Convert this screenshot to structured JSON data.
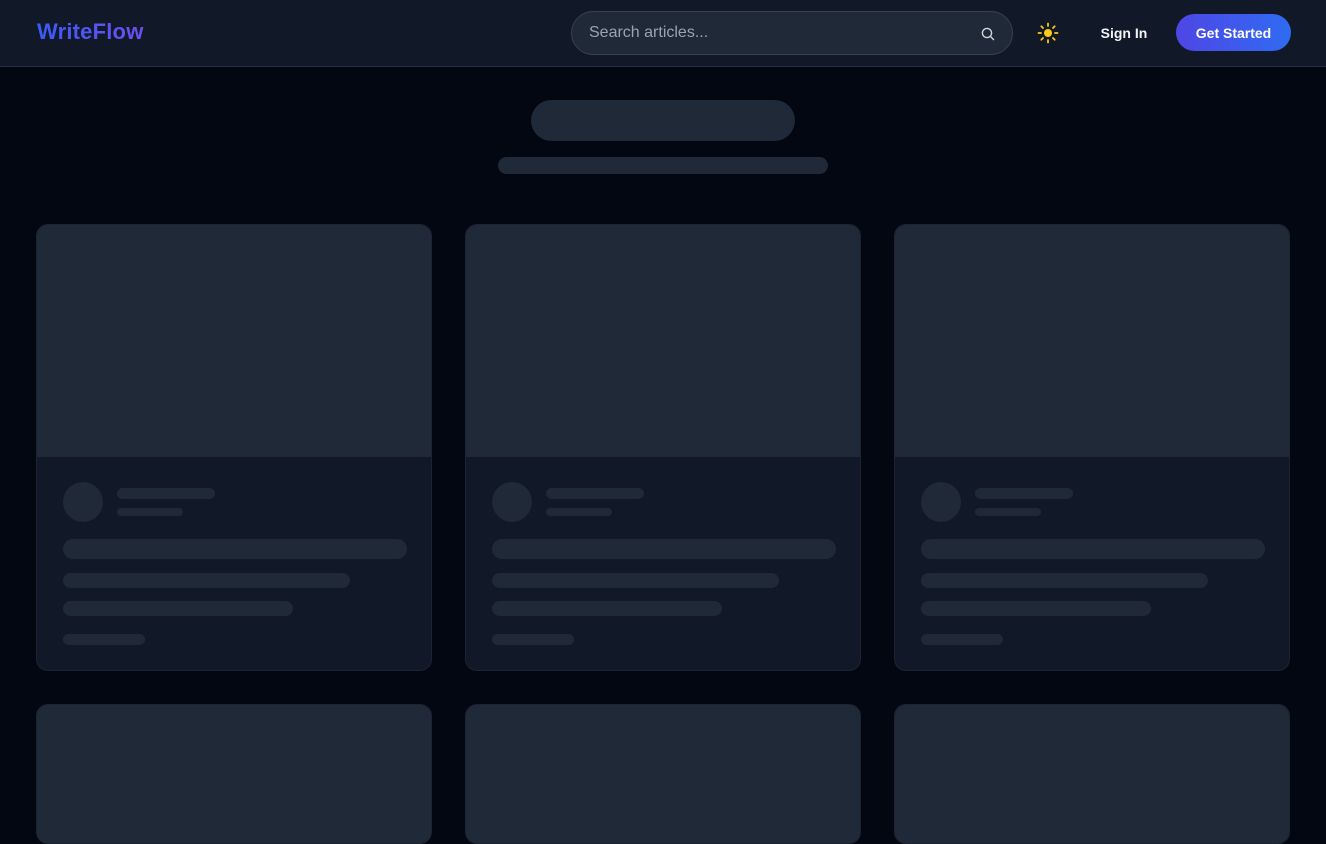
{
  "header": {
    "logo": "WriteFlow",
    "search": {
      "placeholder": "Search articles...",
      "icon": "search-icon"
    },
    "theme_toggle": {
      "icon": "sun-icon",
      "color": "#facc15"
    },
    "sign_in_label": "Sign In",
    "get_started_label": "Get Started"
  },
  "colors": {
    "background": "#030712",
    "header": "#111827",
    "card": "#111827",
    "skeleton": "#1f2937",
    "accent_start": "#4f46e5",
    "accent_end": "#2f6bf2"
  },
  "state": "loading",
  "cards": [
    {
      "state": "loading"
    },
    {
      "state": "loading"
    },
    {
      "state": "loading"
    },
    {
      "state": "loading"
    },
    {
      "state": "loading"
    },
    {
      "state": "loading"
    }
  ]
}
